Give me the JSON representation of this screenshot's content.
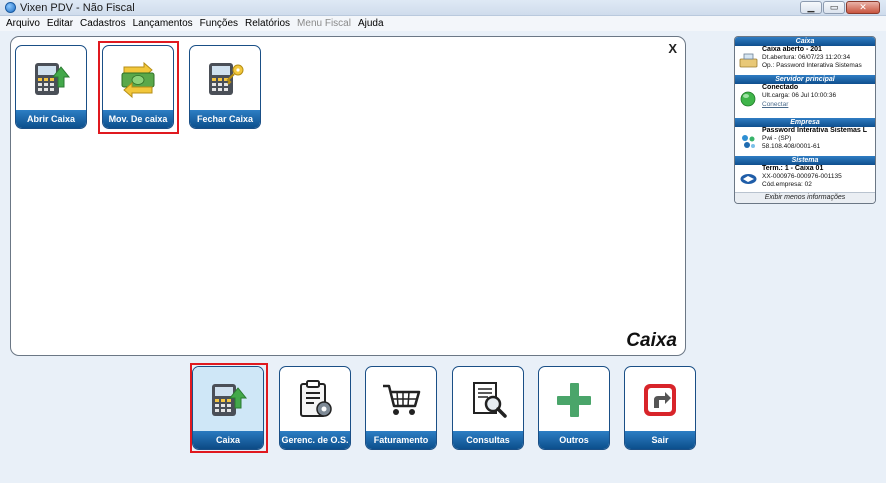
{
  "window": {
    "title": "Vixen PDV - Não Fiscal"
  },
  "menu": [
    "Arquivo",
    "Editar",
    "Cadastros",
    "Lançamentos",
    "Funções",
    "Relatórios",
    "Menu Fiscal",
    "Ajuda"
  ],
  "panel": {
    "title": "Caixa",
    "close_label": "X",
    "tiles": [
      {
        "label": "Abrir Caixa",
        "icon": "pos-terminal-up-arrow-icon"
      },
      {
        "label": "Mov. De caixa",
        "icon": "cash-exchange-icon"
      },
      {
        "label": "Fechar Caixa",
        "icon": "pos-terminal-key-icon"
      }
    ]
  },
  "info": {
    "caixa": {
      "header": "Caixa",
      "line1": "Caixa aberto - 201",
      "line2": "Dt.abertura: 06/07/23 11:20:34",
      "line3": "Op.: Password Interativa Sistemas"
    },
    "servidor": {
      "header": "Servidor principal",
      "line1": "Conectado",
      "line2": "Últ.carga: 06 Jul 10:00:36",
      "link": "Conectar"
    },
    "empresa": {
      "header": "Empresa",
      "line1": "Password Interativa Sistemas L",
      "line2": "Pwi - (SP)",
      "line3": "58.108.408/0001-61"
    },
    "sistema": {
      "header": "Sistema",
      "line1": "Term.: 1 - Caixa 01",
      "line2": "XX-000976-000976-001135",
      "line3": "Cód.empresa: 02"
    },
    "footer": "Exibir menos informações"
  },
  "bottom_tiles": [
    {
      "label": "Caixa",
      "icon": "pos-terminal-icon",
      "active": true
    },
    {
      "label": "Gerenc. de O.S.",
      "icon": "clipboard-gear-icon"
    },
    {
      "label": "Faturamento",
      "icon": "shopping-cart-icon"
    },
    {
      "label": "Consultas",
      "icon": "document-search-icon"
    },
    {
      "label": "Outros",
      "icon": "plus-icon"
    },
    {
      "label": "Sair",
      "icon": "exit-icon"
    }
  ],
  "colors": {
    "tile_label_bg": "#0c4f8c",
    "highlight": "#e0191f",
    "plus_green": "#4aa56a",
    "exit_red": "#d8242a"
  }
}
